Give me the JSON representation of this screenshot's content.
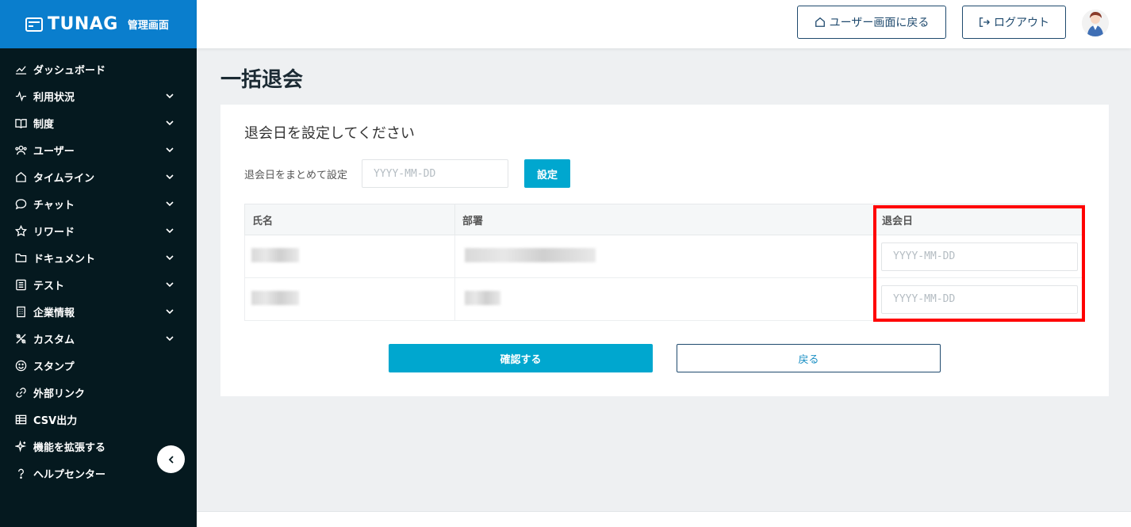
{
  "brand": {
    "name": "TUNAG",
    "subtitle": "管理画面"
  },
  "header": {
    "user_screen_label": "ユーザー画面に戻る",
    "logout_label": "ログアウト"
  },
  "sidebar": {
    "items": [
      {
        "label": "ダッシュボード",
        "icon": "chart-icon",
        "expandable": false
      },
      {
        "label": "利用状況",
        "icon": "pulse-icon",
        "expandable": true
      },
      {
        "label": "制度",
        "icon": "book-icon",
        "expandable": true
      },
      {
        "label": "ユーザー",
        "icon": "users-icon",
        "expandable": true
      },
      {
        "label": "タイムライン",
        "icon": "home-icon",
        "expandable": true
      },
      {
        "label": "チャット",
        "icon": "chat-icon",
        "expandable": true
      },
      {
        "label": "リワード",
        "icon": "star-icon",
        "expandable": true
      },
      {
        "label": "ドキュメント",
        "icon": "folder-icon",
        "expandable": true
      },
      {
        "label": "テスト",
        "icon": "checklist-icon",
        "expandable": true
      },
      {
        "label": "企業情報",
        "icon": "building-icon",
        "expandable": true
      },
      {
        "label": "カスタム",
        "icon": "tools-icon",
        "expandable": true
      },
      {
        "label": "スタンプ",
        "icon": "smile-icon",
        "expandable": false
      },
      {
        "label": "外部リンク",
        "icon": "link-icon",
        "expandable": false
      },
      {
        "label": "CSV出力",
        "icon": "table-icon",
        "expandable": false
      },
      {
        "label": "機能を拡張する",
        "icon": "sparkle-icon",
        "expandable": false
      },
      {
        "label": "ヘルプセンター",
        "icon": "help-icon",
        "expandable": false
      }
    ]
  },
  "page": {
    "title": "一括退会"
  },
  "form": {
    "heading": "退会日を設定してください",
    "bulk_label": "退会日をまとめて設定",
    "bulk_placeholder": "YYYY-MM-DD",
    "set_label": "設定"
  },
  "table": {
    "columns": [
      "氏名",
      "部署",
      "退会日"
    ],
    "rows": [
      {
        "date_placeholder": "YYYY-MM-DD"
      },
      {
        "date_placeholder": "YYYY-MM-DD"
      }
    ]
  },
  "actions": {
    "confirm_label": "確認する",
    "back_label": "戻る"
  },
  "colors": {
    "brand": "#0a7ecd",
    "sidebar": "#05191f",
    "accent": "#00a7cf",
    "highlight": "#ff0000"
  }
}
